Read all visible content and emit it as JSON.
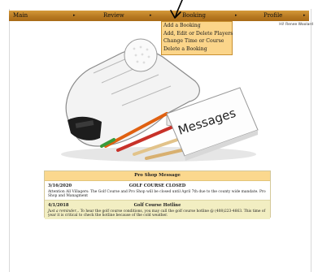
{
  "nav": {
    "items": [
      {
        "label": "Main"
      },
      {
        "label": "Review"
      },
      {
        "label": "Booking"
      },
      {
        "label": "Profile"
      }
    ],
    "separator": "▸"
  },
  "greeting": "Hi! Renee Woolard",
  "dropdown": {
    "items": [
      "Add a Booking",
      "Add, Edit or Delete Players",
      "Change Time or Course",
      "Delete a Booking"
    ]
  },
  "hero": {
    "note_text": "Messages"
  },
  "pro_shop": {
    "header": "Pro Shop Message",
    "messages": [
      {
        "date": "3/16/2020",
        "title": "GOLF COURSE CLOSED",
        "lead": "",
        "body": "Attention All Villagers: The Golf Course and Pro Shop will be closed until April 7th due to the county wide mandate. Pro Shop and Managment"
      },
      {
        "date": "4/1/2018",
        "title": "Golf Course Hotline",
        "lead": "Just a reminder...",
        "body": " To hear the golf course conditions, you may call the golf course hotline @ (408)223-4663. This time of year it is critical to check the hotline because of the cold weather."
      }
    ]
  },
  "colors": {
    "nav_bar": "#b87a22",
    "dropdown_bg": "#fbd58a",
    "panel_header": "#fbd88e",
    "message_alt_bg": "#f2eec2"
  }
}
